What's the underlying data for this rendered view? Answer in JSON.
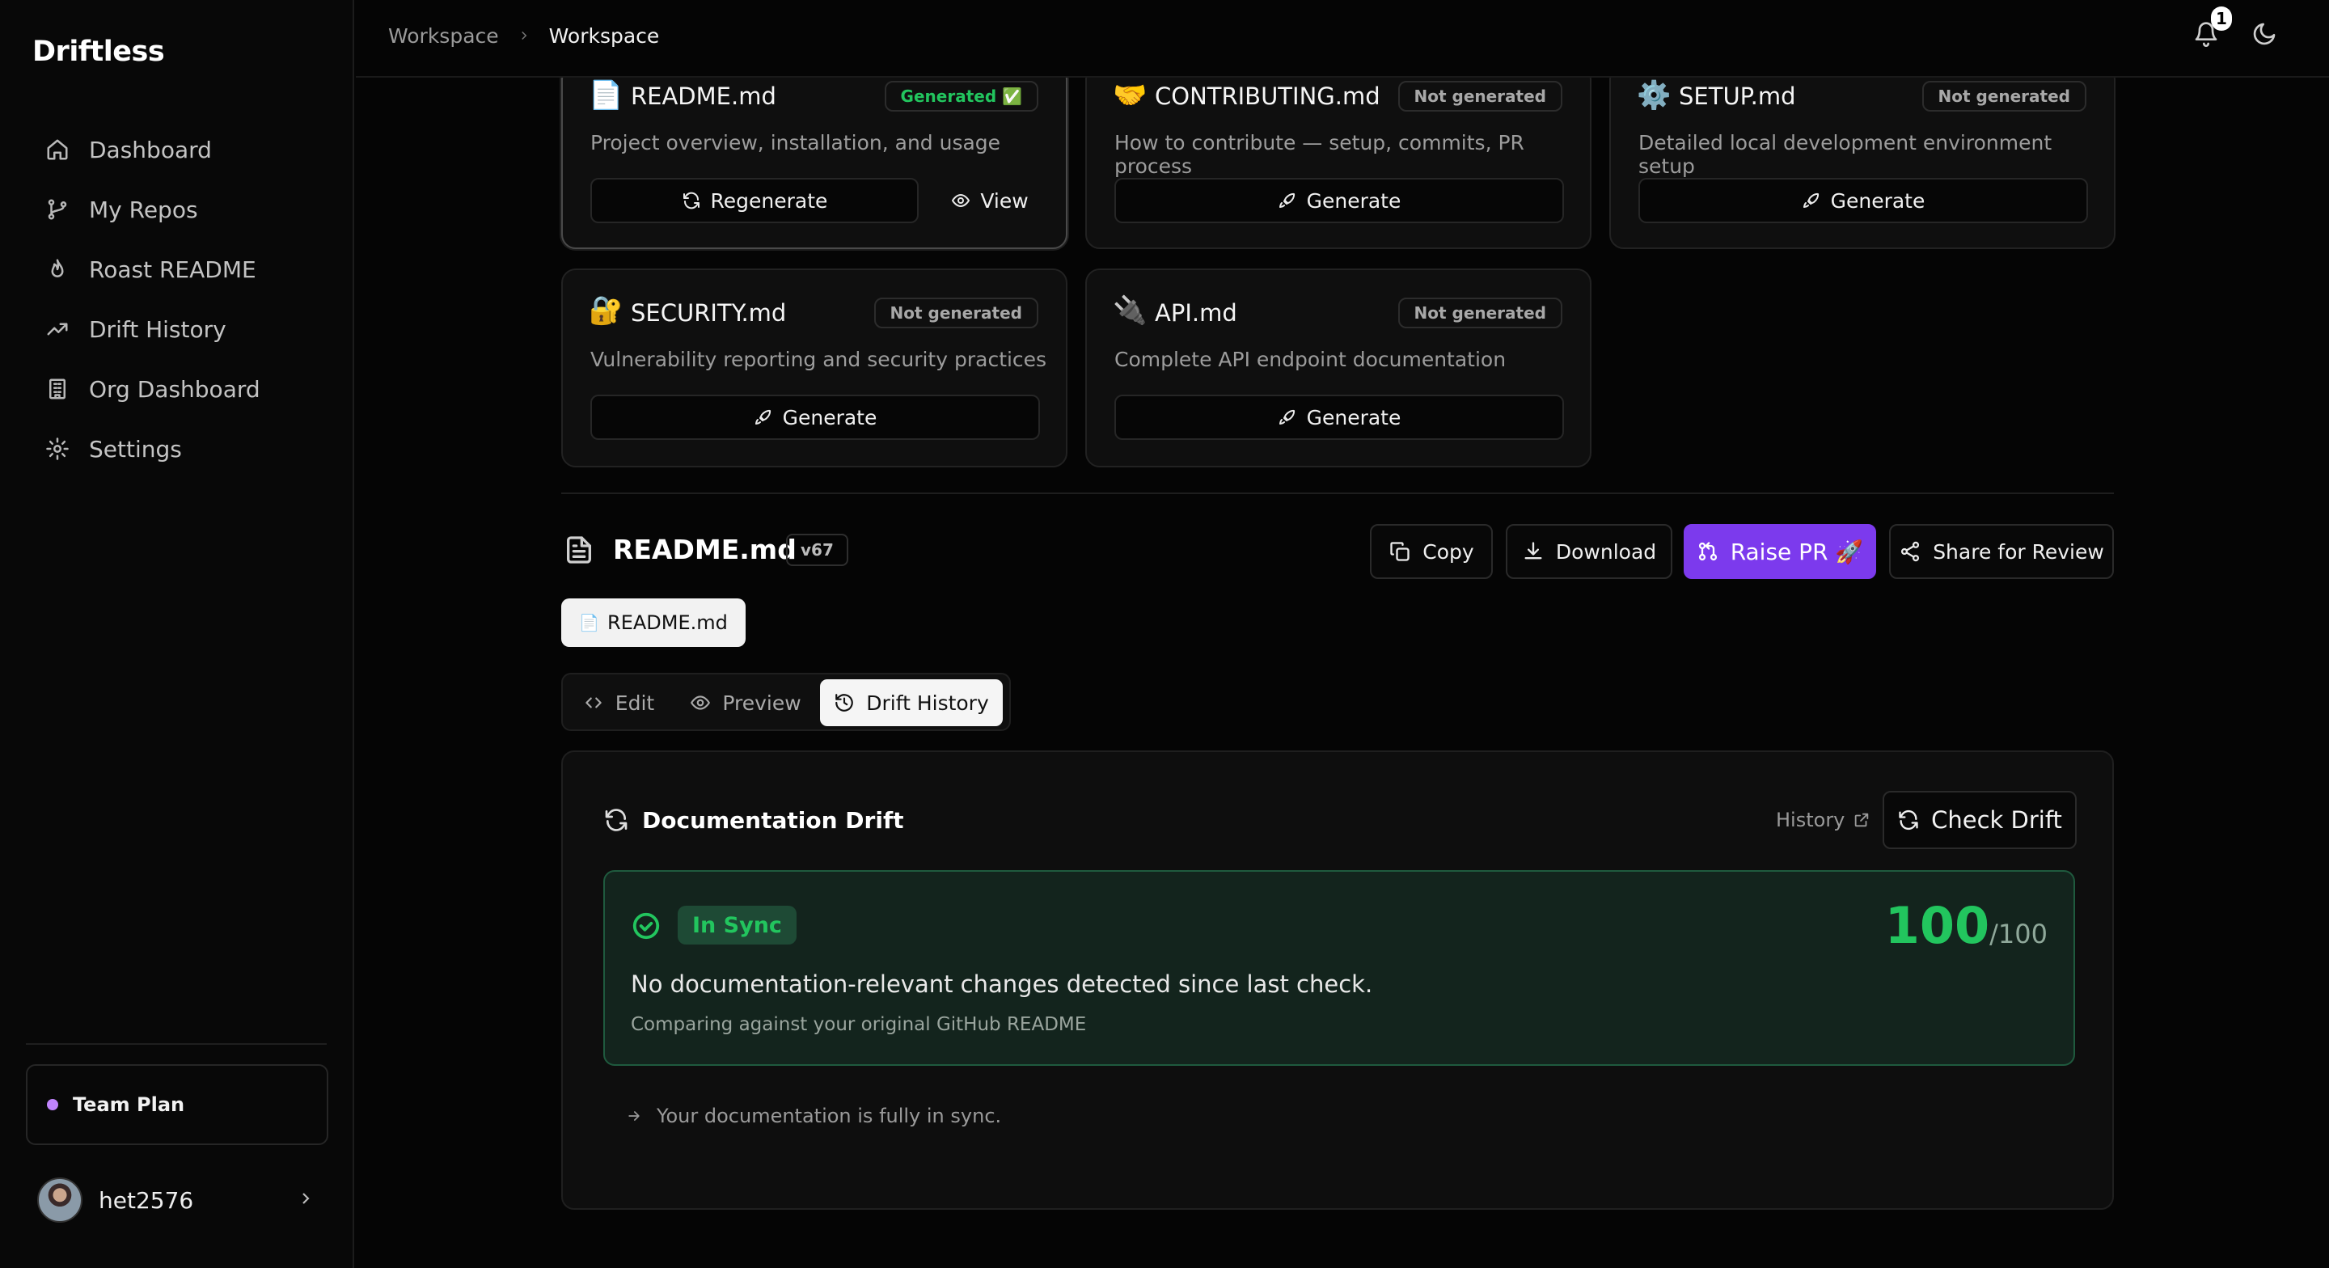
{
  "app": {
    "brand": "Driftless"
  },
  "sidebar": {
    "items": [
      {
        "label": "Dashboard",
        "icon": "home-icon"
      },
      {
        "label": "My Repos",
        "icon": "git-branch-icon"
      },
      {
        "label": "Roast README",
        "icon": "flame-icon"
      },
      {
        "label": "Drift History",
        "icon": "trending-up-icon"
      },
      {
        "label": "Org Dashboard",
        "icon": "building-icon"
      },
      {
        "label": "Settings",
        "icon": "gear-icon"
      }
    ],
    "plan": "Team Plan",
    "plan_dot_color": "#c084fc",
    "user": "het2576"
  },
  "header": {
    "breadcrumb": [
      "Workspace",
      "Workspace"
    ],
    "notification_count": "1"
  },
  "cards": [
    {
      "emoji": "📄",
      "title": "README.md",
      "status": "Generated ✅",
      "description": "Project overview, installation, and usage",
      "primary": "Regenerate",
      "secondary": "View"
    },
    {
      "emoji": "🤝",
      "title": "CONTRIBUTING.md",
      "status": "Not generated",
      "description": "How to contribute — setup, commits, PR process",
      "primary": "Generate"
    },
    {
      "emoji": "⚙️",
      "title": "SETUP.md",
      "status": "Not generated",
      "description": "Detailed local development environment setup",
      "primary": "Generate"
    },
    {
      "emoji": "🔐",
      "title": "SECURITY.md",
      "status": "Not generated",
      "description": "Vulnerability reporting and security practices",
      "primary": "Generate"
    },
    {
      "emoji": "🔌",
      "title": "API.md",
      "status": "Not generated",
      "description": "Complete API endpoint documentation",
      "primary": "Generate"
    }
  ],
  "doc": {
    "title": "README.md",
    "version": "v67",
    "actions": {
      "copy": "Copy",
      "download": "Download",
      "raise_pr": "Raise PR 🚀",
      "share": "Share for Review"
    },
    "file_chip": "README.md",
    "file_chip_emoji": "📄",
    "tabs": [
      "Edit",
      "Preview",
      "Drift History"
    ],
    "active_tab": "Drift History"
  },
  "drift": {
    "title": "Documentation Drift",
    "history_link": "History",
    "check_button": "Check Drift",
    "status": "In Sync",
    "score": "100",
    "score_max": "/100",
    "message": "No documentation-relevant changes detected since last check.",
    "comparison": "Comparing against your original GitHub README",
    "footnote": "Your documentation is fully in sync.",
    "status_color": "#22c55e",
    "accent_color": "#7c3aed"
  }
}
